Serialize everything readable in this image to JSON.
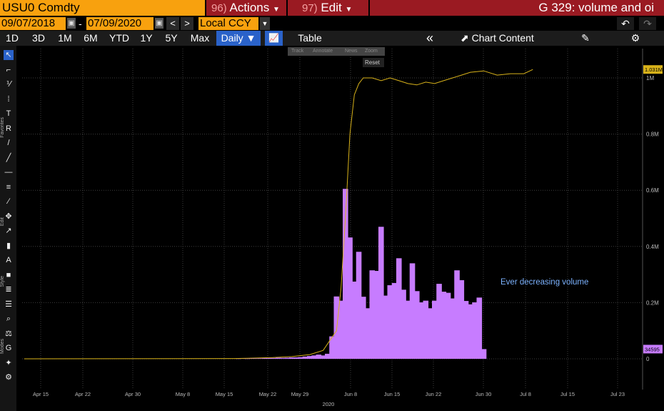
{
  "header": {
    "ticker": "USU0 Comdty",
    "actions_num": "96)",
    "actions_label": "Actions",
    "edit_num": "97)",
    "edit_label": "Edit",
    "chart_title": "G 329: volume and oi"
  },
  "date_bar": {
    "start_date": "09/07/2018",
    "dash": "-",
    "end_date": "07/09/2020",
    "currency": "Local CCY",
    "calendar_glyph": "▣",
    "prev_glyph": "<",
    "next_glyph": ">",
    "dropdown_glyph": "▼",
    "undo_glyph": "↶",
    "redo_glyph": "↷"
  },
  "toolbar": {
    "ranges": [
      "1D",
      "3D",
      "1M",
      "6M",
      "YTD",
      "1Y",
      "5Y",
      "Max"
    ],
    "frequency": "Daily ▼",
    "line_icon_glyph": "📈",
    "table_label": "Table",
    "collapse_glyph": "«",
    "chart_content_label": "Chart Content",
    "chart_content_glyph": "⬈",
    "edit_glyph": "✎",
    "settings_glyph": "⚙"
  },
  "zoom_tools": {
    "track": "Track",
    "annotate": "Annotate",
    "news": "News",
    "zoom": "Zoom",
    "reset": "Reset"
  },
  "left_tools": {
    "labels": [
      "Favorites",
      "Edit",
      "Style",
      "Modes"
    ],
    "glyphs": [
      "↖",
      "⌐",
      "⅟",
      "⁞",
      "T",
      "R",
      "/",
      "╱",
      "—",
      "≡",
      "∕",
      "✥",
      "↗",
      "▮",
      "A",
      "■",
      "≣",
      "☰",
      "⌕",
      "⚖",
      "G",
      "✦",
      "⚙"
    ]
  },
  "colors": {
    "background": "#000000",
    "grid": "#3c3c3c",
    "volume_bar": "#c77cff",
    "open_interest_line": "#d8b21a",
    "annotation_text": "#7cb2ff",
    "ticker_bg": "#f8a10e",
    "header_bg": "#9a1a22",
    "active_button": "#2a62c9"
  },
  "chart_data": {
    "type": "bar",
    "x_tick_labels": [
      "Apr 15",
      "Apr 22",
      "Apr 30",
      "May 8",
      "May 15",
      "May 22",
      "May 29",
      "Jun 8",
      "Jun 15",
      "Jun 22",
      "Jun 30",
      "Jul 8",
      "Jul 15",
      "Jul 23"
    ],
    "x_axis_year": "2020",
    "y_tick_labels": [
      "1M",
      "0.8M",
      "0.6M",
      "0.4M",
      "0.2M",
      "0"
    ],
    "ylim": [
      0,
      1000000
    ],
    "last_oi_label": "1.031M",
    "last_volume_label": "34595",
    "annotation": "Ever decreasing volume",
    "series": [
      {
        "type": "bar",
        "values": [
          0,
          0,
          0,
          0,
          0,
          0,
          0,
          0,
          0,
          0,
          0,
          0,
          0,
          0,
          0,
          0,
          0,
          0,
          0,
          0,
          0,
          0,
          0,
          0,
          0,
          0,
          0,
          0,
          0,
          0,
          0,
          0,
          0,
          0,
          0,
          0,
          0,
          0,
          0,
          0,
          0,
          0,
          0,
          0,
          0,
          0,
          0,
          0,
          1000,
          1500,
          1000,
          2000,
          1500,
          2000,
          2500,
          3000,
          3000,
          4000,
          3500,
          4000,
          5000,
          5000,
          6000,
          8000,
          10000,
          12000,
          15000,
          12000,
          18000,
          80000,
          222000,
          207000,
          605000,
          432000,
          275000,
          381000,
          221000,
          180000,
          315000,
          313000,
          470000,
          225000,
          262000,
          270000,
          358000,
          246000,
          207000,
          340000,
          241000,
          201000,
          207000,
          180000,
          207000,
          267000,
          239000,
          235000,
          215000,
          315000,
          280000,
          206000,
          194000,
          201000,
          218000,
          34595
        ]
      },
      {
        "type": "line",
        "points": [
          [
            0,
            0
          ],
          [
            47,
            1000
          ],
          [
            50,
            2000
          ],
          [
            55,
            4000
          ],
          [
            60,
            8000
          ],
          [
            64,
            15000
          ],
          [
            67,
            30000
          ],
          [
            70,
            100000
          ],
          [
            71,
            250000
          ],
          [
            72,
            500000
          ],
          [
            73,
            800000
          ],
          [
            74,
            940000
          ],
          [
            75,
            980000
          ],
          [
            76,
            1000000
          ],
          [
            78,
            1000000
          ],
          [
            80,
            990000
          ],
          [
            82,
            1000000
          ],
          [
            84,
            990000
          ],
          [
            86,
            980000
          ],
          [
            88,
            975000
          ],
          [
            90,
            985000
          ],
          [
            92,
            980000
          ],
          [
            94,
            990000
          ],
          [
            96,
            1000000
          ],
          [
            98,
            1010000
          ],
          [
            100,
            1020000
          ],
          [
            103,
            1025000
          ],
          [
            106,
            1010000
          ],
          [
            109,
            1015000
          ],
          [
            112,
            1015000
          ],
          [
            114,
            1030000
          ]
        ]
      }
    ]
  }
}
